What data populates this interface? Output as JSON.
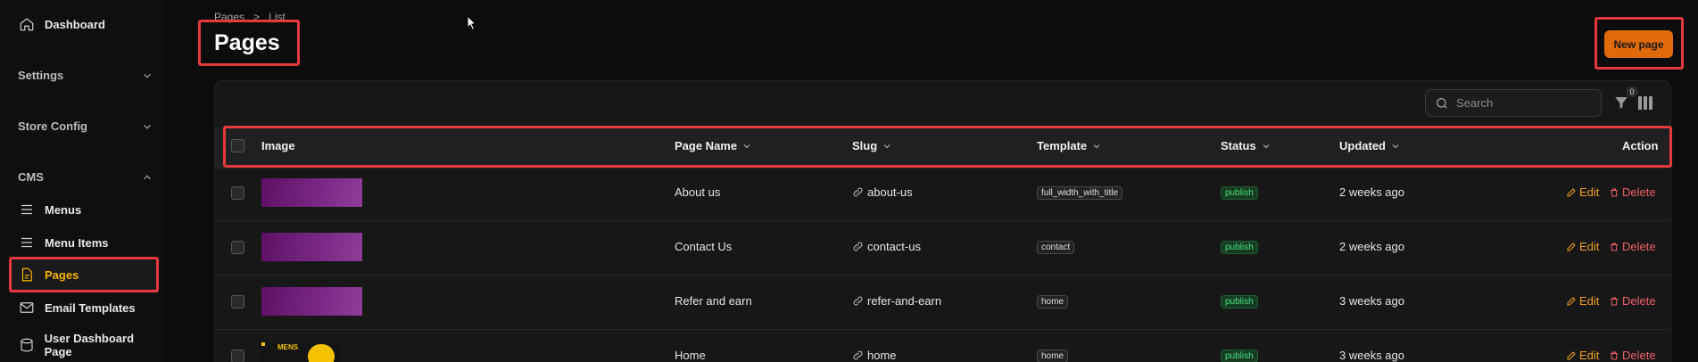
{
  "sidebar": {
    "dashboard": "Dashboard",
    "settings": "Settings",
    "store_config": "Store Config",
    "cms": "CMS",
    "menus": "Menus",
    "menu_items": "Menu Items",
    "pages": "Pages",
    "email_templates": "Email Templates",
    "user_dashboard_page": "User Dashboard Page"
  },
  "breadcrumb": {
    "first": "Pages",
    "separator": ">",
    "second": "List"
  },
  "header": {
    "title": "Pages",
    "new_page_label": "New page"
  },
  "toolbar": {
    "search_placeholder": "Search",
    "filter_count": "0"
  },
  "table": {
    "columns": {
      "image": "Image",
      "page_name": "Page Name",
      "slug": "Slug",
      "template": "Template",
      "status": "Status",
      "updated": "Updated",
      "action": "Action"
    },
    "rows": [
      {
        "page_name": "About us",
        "slug": "about-us",
        "template": "full_width_with_title",
        "status": "publish",
        "updated": "2 weeks ago",
        "edit": "Edit",
        "delete": "Delete"
      },
      {
        "page_name": "Contact Us",
        "slug": "contact-us",
        "template": "contact",
        "status": "publish",
        "updated": "2 weeks ago",
        "edit": "Edit",
        "delete": "Delete"
      },
      {
        "page_name": "Refer and earn",
        "slug": "refer-and-earn",
        "template": "home",
        "status": "publish",
        "updated": "3 weeks ago",
        "edit": "Edit",
        "delete": "Delete"
      },
      {
        "page_name": "Home",
        "slug": "home",
        "template": "home",
        "status": "publish",
        "updated": "3 weeks ago",
        "edit": "Edit",
        "delete": "Delete",
        "thumb_text": "MENS"
      }
    ]
  },
  "colors": {
    "accent": "#e0690a",
    "highlight": "#e5393e",
    "active": "#f4b400"
  }
}
